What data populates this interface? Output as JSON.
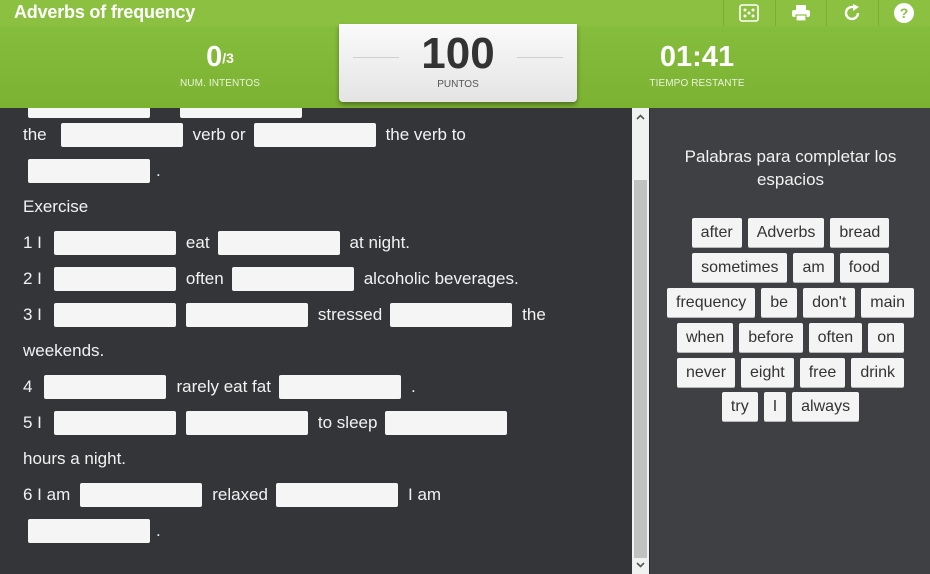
{
  "header": {
    "title": "Adverbs of frequency",
    "tools": [
      "dice-icon",
      "print-icon",
      "refresh-icon",
      "help-icon"
    ]
  },
  "stats": {
    "attempts_value": "0",
    "attempts_total": "/3",
    "attempts_label": "NUM. INTENTOS",
    "points_value": "100",
    "points_label": "PUNTOS",
    "time_value": "01:41",
    "time_label": "TIEMPO RESTANTE"
  },
  "exercise": {
    "row_a": [
      "the",
      "verb or",
      "the verb to"
    ],
    "row_b_end": ".",
    "heading": "Exercise",
    "row_1": [
      "1 I",
      "eat",
      "at night."
    ],
    "row_2": [
      "2 I",
      "often",
      "alcoholic beverages."
    ],
    "row_3": [
      "3 I",
      "stressed",
      "the"
    ],
    "row_3b": "weekends.",
    "row_4": [
      "4",
      "rarely eat fat",
      "."
    ],
    "row_5": [
      "5 I",
      "to sleep"
    ],
    "row_5b": "hours a night.",
    "row_6": [
      "6 I am",
      "relaxed",
      "I am"
    ],
    "row_6b_end": "."
  },
  "word_bank": {
    "title": "Palabras para completar los espacios",
    "rows": [
      [
        "after",
        "Adverbs",
        "bread"
      ],
      [
        "sometimes",
        "am",
        "food"
      ],
      [
        "frequency",
        "be",
        "don't",
        "main"
      ],
      [
        "when",
        "before",
        "often",
        "on"
      ],
      [
        "never",
        "eight",
        "free",
        "drink"
      ],
      [
        "try",
        "I",
        "always"
      ]
    ]
  },
  "colors": {
    "header_green": "#8cc041",
    "panel_dark": "#333539",
    "bank_dark": "#3e4043"
  }
}
